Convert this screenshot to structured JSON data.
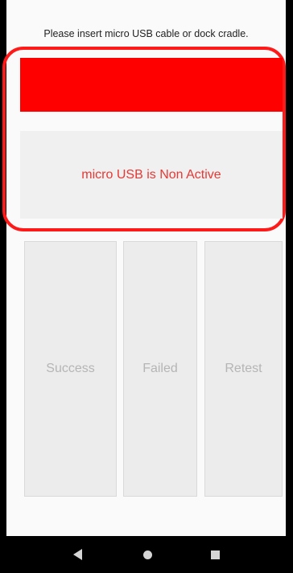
{
  "instruction": "Please insert micro USB cable or dock cradle.",
  "status": {
    "indicator_color": "#ff0000",
    "message": "micro USB is Non Active",
    "message_color": "#e53935"
  },
  "buttons": {
    "success": "Success",
    "failed": "Failed",
    "retest": "Retest"
  },
  "nav": {
    "back_icon": "back-triangle",
    "home_icon": "home-circle",
    "recents_icon": "recents-square"
  }
}
